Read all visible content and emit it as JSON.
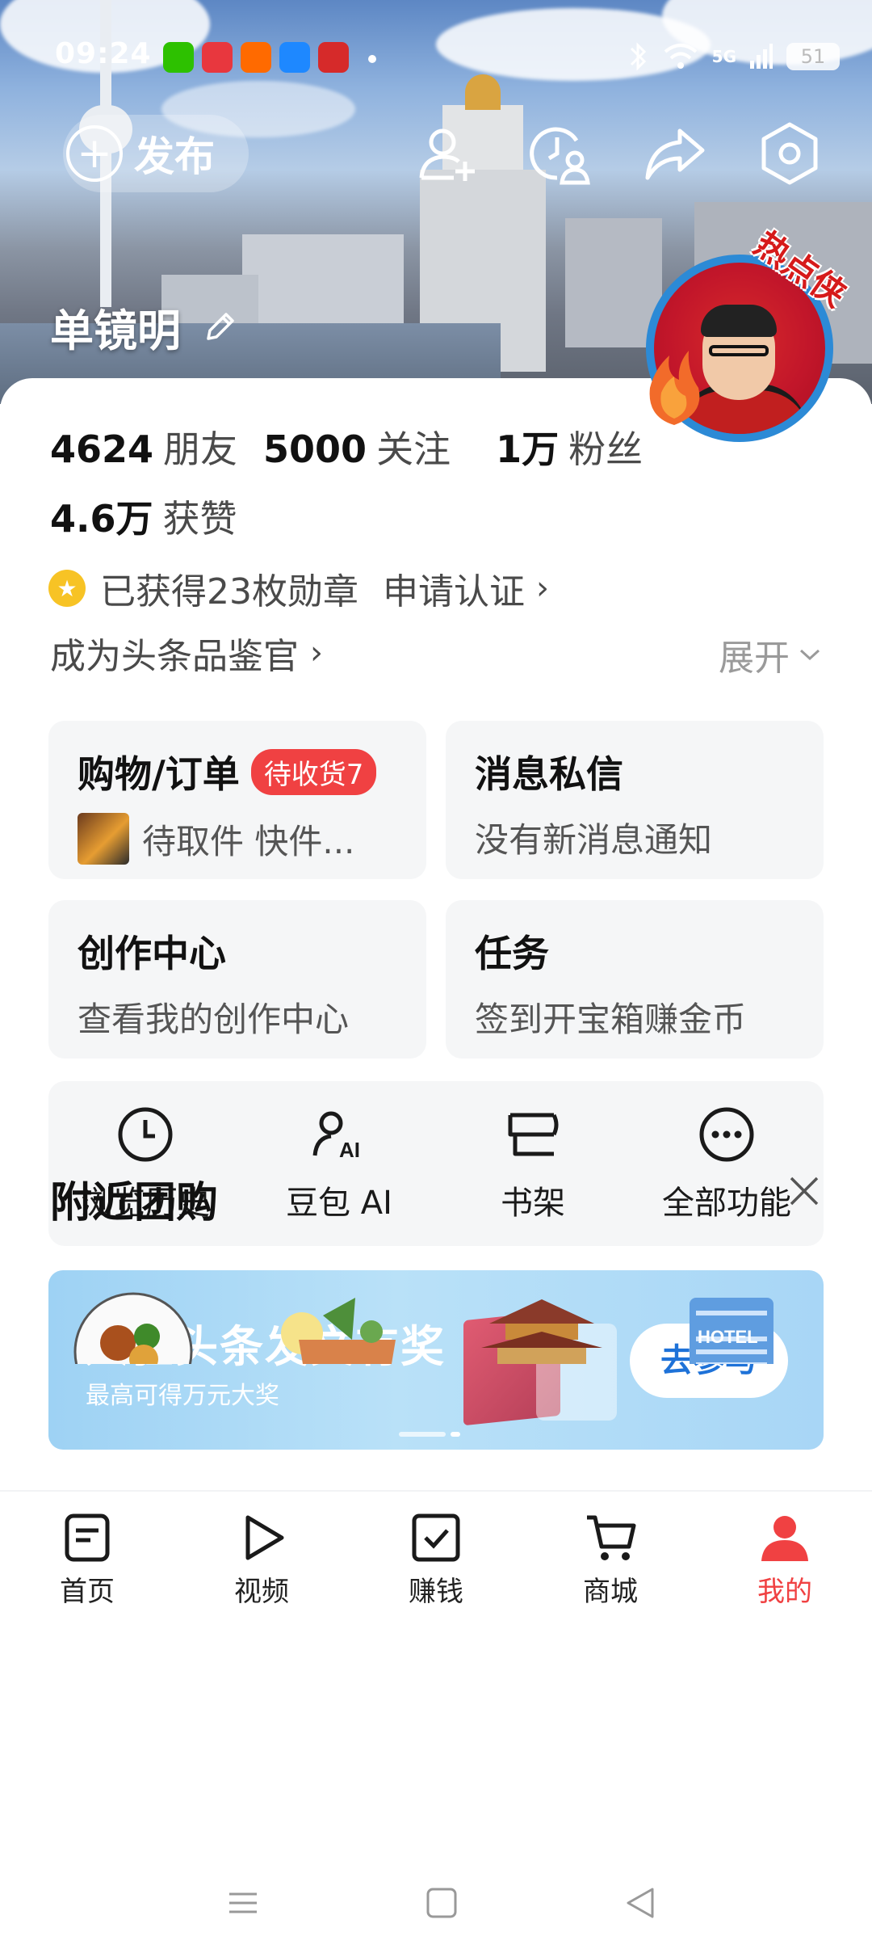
{
  "status_bar": {
    "time": "09:24",
    "network": "5G",
    "battery": "51",
    "app_icons": [
      {
        "name": "wechat-icon",
        "color": "#2dc100"
      },
      {
        "name": "toutiao-icon",
        "color": "#e8373e"
      },
      {
        "name": "taobao-icon",
        "color": "#ff6a00"
      },
      {
        "name": "blue-app-icon",
        "color": "#1e88ff"
      },
      {
        "name": "game-app-icon",
        "color": "#d62a2a"
      }
    ]
  },
  "header": {
    "publish_label": "发布",
    "username": "单镜明",
    "avatar_badge": "热点侠"
  },
  "stats": {
    "friends_count": "4624",
    "friends_label": "朋友",
    "following_count": "5000",
    "following_label": "关注",
    "followers_count": "1万",
    "followers_label": "粉丝",
    "likes_count": "4.6万",
    "likes_label": "获赞"
  },
  "medals": {
    "text": "已获得23枚勋章",
    "apply_label": "申请认证"
  },
  "judge": {
    "label": "成为头条品鉴官",
    "expand_label": "展开"
  },
  "tiles": {
    "shopping": {
      "title": "购物/订单",
      "badge": "待收货7",
      "subtitle": "待取件 快件..."
    },
    "messages": {
      "title": "消息私信",
      "subtitle": "没有新消息通知"
    },
    "creator": {
      "title": "创作中心",
      "subtitle": "查看我的创作中心"
    },
    "tasks": {
      "title": "任务",
      "subtitle": "签到开宝箱赚金币"
    }
  },
  "shortcuts": [
    {
      "label": "浏览历史",
      "icon": "clock-icon"
    },
    {
      "label": "豆包 AI",
      "icon": "doubao-ai-icon"
    },
    {
      "label": "书架",
      "icon": "bookshelf-icon"
    },
    {
      "label": "全部功能",
      "icon": "more-icon"
    }
  ],
  "promo": {
    "title": "入驻头条发文有奖",
    "subtitle": "最高可得万元大奖",
    "button": "去参与"
  },
  "nearby": {
    "title": "附近团购",
    "hotel_sign": "HOTEL"
  },
  "bottom_nav": [
    {
      "label": "首页",
      "icon": "home-icon"
    },
    {
      "label": "视频",
      "icon": "video-play-icon"
    },
    {
      "label": "赚钱",
      "icon": "earn-check-icon"
    },
    {
      "label": "商城",
      "icon": "cart-icon"
    },
    {
      "label": "我的",
      "icon": "profile-icon"
    }
  ],
  "colors": {
    "accent_red": "#f04142",
    "promo_blue": "#1e72d8",
    "avatar_ring": "#2c8ad6"
  }
}
